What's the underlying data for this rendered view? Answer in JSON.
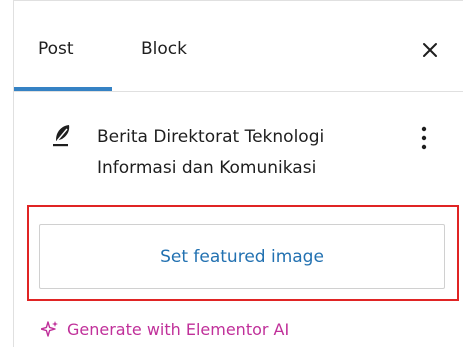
{
  "tabs": {
    "post_label": "Post",
    "block_label": "Block",
    "active": "Post"
  },
  "icons": {
    "close": "close-icon",
    "post_type": "feather-icon",
    "more": "more-vertical-icon",
    "ai": "sparkle-icon"
  },
  "post": {
    "title": "Berita Direktorat Teknologi Informasi dan Komunikasi"
  },
  "featured_image": {
    "button_label": "Set featured image"
  },
  "ai": {
    "label": "Generate with Elementor AI"
  },
  "colors": {
    "accent": "#3582c4",
    "link": "#2271b1",
    "highlight_border": "#e02424",
    "ai_magenta": "#c0309a"
  }
}
